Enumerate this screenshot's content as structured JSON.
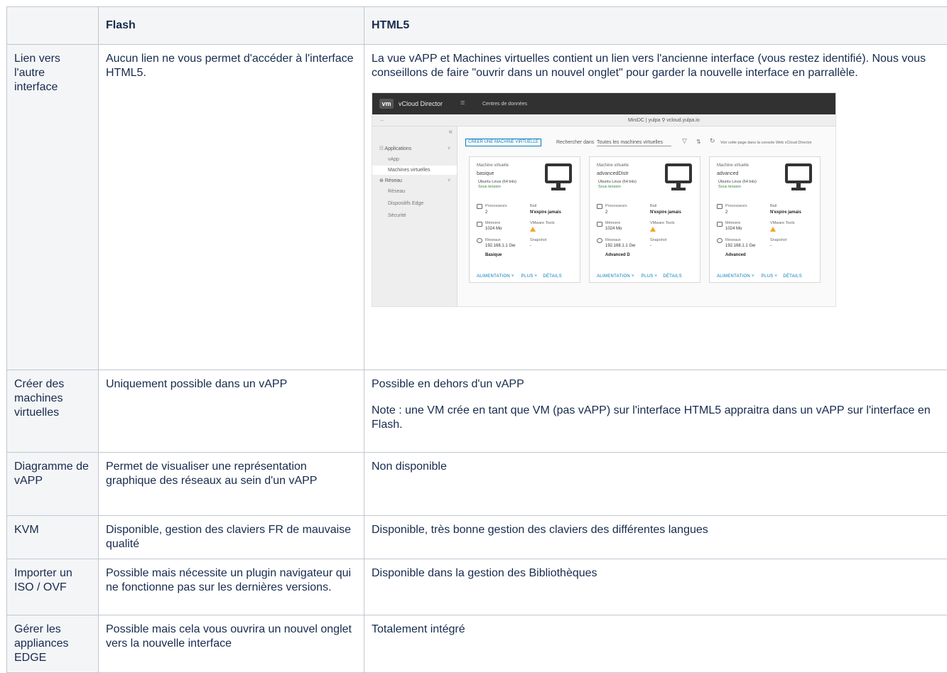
{
  "headers": [
    "",
    "Flash",
    "HTML5"
  ],
  "rows": [
    {
      "feature": "Lien vers l'autre interface",
      "flash": "Aucun lien ne vous permet d'accéder à l'interface HTML5.",
      "html5": [
        "La vue vAPP et Machines virtuelles contient un lien vers l'ancienne interface (vous restez identifié). Nous vous conseillons de faire \"ouvrir dans un nouvel onglet\" pour garder la nouvelle interface en parrallèle."
      ]
    },
    {
      "feature": "Créer des machines virtuelles",
      "flash": "Uniquement possible dans un vAPP",
      "html5": [
        "Possible en dehors d'un vAPP",
        "Note : une VM crée en tant que VM (pas vAPP) sur l'interface HTML5 appraitra dans un vAPP sur l'interface en Flash."
      ]
    },
    {
      "feature": "Diagramme de vAPP",
      "flash": "Permet de visualiser une représentation graphique des réseaux au sein d'un vAPP",
      "html5": [
        "Non disponible"
      ]
    },
    {
      "feature": "KVM",
      "flash": "Disponible, gestion des claviers FR de mauvaise qualité",
      "html5": [
        "Disponible, très bonne gestion des claviers des différentes langues"
      ]
    },
    {
      "feature": "Importer un ISO / OVF",
      "flash": "Possible mais nécessite un plugin navigateur qui ne fonctionne pas sur les dernières versions.",
      "html5": [
        "Disponible dans la gestion des Bibliothèques"
      ]
    },
    {
      "feature": "Gérer les appliances EDGE",
      "flash": "Possible mais cela vous ouvrira un nouvel onglet vers la nouvelle interface",
      "html5": [
        "Totalement intégré"
      ]
    }
  ],
  "screenshot": {
    "logo": "vm",
    "brand": "vCloud Director",
    "menu_icon": "≡",
    "datacenters": "Centres de données",
    "back_arrow": "←",
    "location": "MiniDC  |  yulpa  ⚲ vcloud.yulpa.io",
    "collapse": "«",
    "sidebar": {
      "applications": "Applications",
      "vapp": "vApp",
      "vms": "Machines virtuelles",
      "network_group": "Réseau",
      "network": "Réseau",
      "edge": "Dispositifs Edge",
      "security": "Sécurité"
    },
    "create_vm": "CRÉER UNE MACHINE VIRTUELLE",
    "search_in": "Rechercher dans",
    "search_scope": "Toutes les machines virtuelles",
    "funnel": "▽",
    "sort": "⇅",
    "refresh": "↻",
    "console_link": "Voir cette page dans la console Web vCloud Director",
    "labels": {
      "vm": "Machine virtuelle",
      "cpu": "Processeurs",
      "lease": "Bail",
      "memory": "Mémoire",
      "tools": "VMware Tools",
      "networks": "Réseaux",
      "snapshot": "Snapshot",
      "power": "ALIMENTATION ˅",
      "more": "PLUS ˅",
      "details": "DÉTAILS"
    },
    "cards": [
      {
        "name": "basique",
        "os": "Ubuntu Linux (64 bits)",
        "state": "Sous tension",
        "cpu": "2",
        "lease": "N'expire jamais",
        "memory": "1024 Mo",
        "network": "192.168.1.1 Gw",
        "snapshot": "-",
        "network_name": "Basique"
      },
      {
        "name": "advancedDistr",
        "os": "Ubuntu Linux (64 bits)",
        "state": "Sous tension",
        "cpu": "2",
        "lease": "N'expire jamais",
        "memory": "1024 Mo",
        "network": "192.168.1.1 Gw",
        "snapshot": "-",
        "network_name": "Advanced D"
      },
      {
        "name": "advanced",
        "os": "Ubuntu Linux (64 bits)",
        "state": "Sous tension",
        "cpu": "2",
        "lease": "N'expire jamais",
        "memory": "1024 Mo",
        "network": "192.168.1.1 Gw",
        "snapshot": "-",
        "network_name": "Advanced"
      }
    ]
  }
}
